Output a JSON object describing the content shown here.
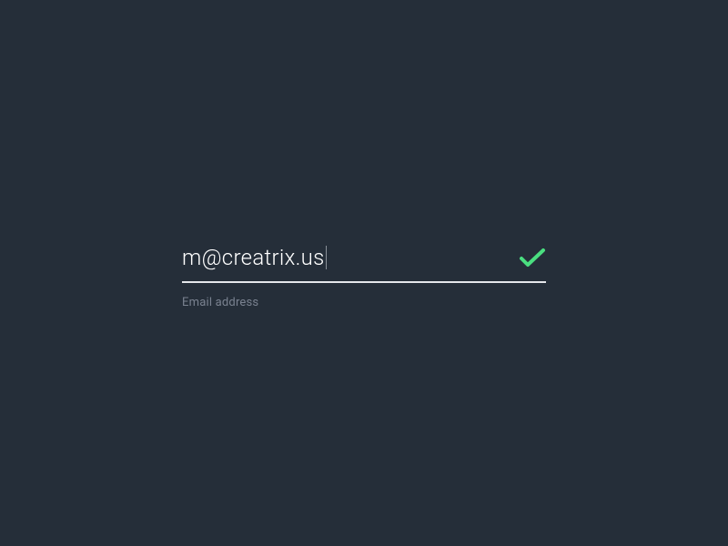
{
  "form": {
    "email": {
      "value": "m@creatrix.us",
      "label": "Email address",
      "valid": true
    }
  },
  "colors": {
    "background": "#252e39",
    "text": "#ffffff",
    "label": "#7a8290",
    "underline": "#e5e7eb",
    "success": "#4ade80"
  }
}
